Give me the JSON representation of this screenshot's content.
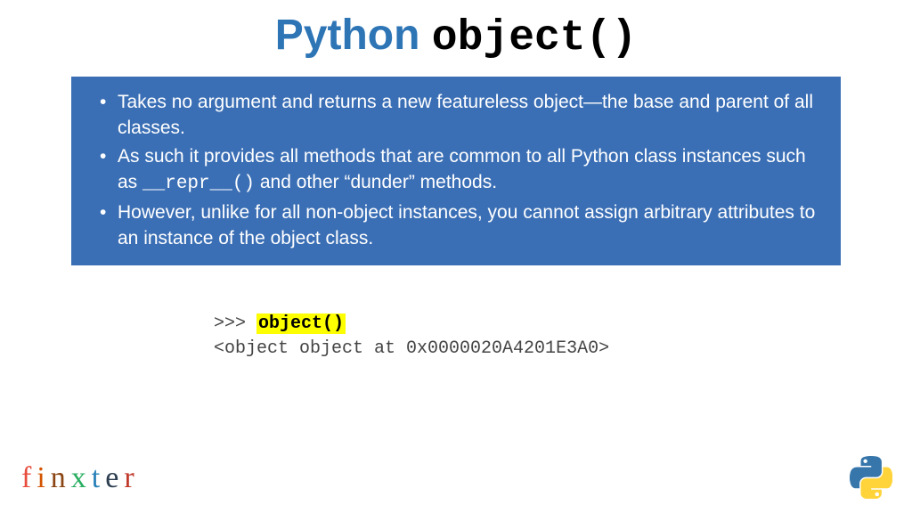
{
  "title": {
    "prefix": "Python ",
    "code": "object()"
  },
  "bullets": {
    "item1": "Takes no argument and returns a new featureless object—the base and parent of all classes.",
    "item2a": "As such it provides all methods that are common to all Python class instances such as ",
    "item2code": "__repr__()",
    "item2b": " and other “dunder” methods.",
    "item3": "However, unlike for all non-object instances, you cannot assign arbitrary attributes to an instance of the object class."
  },
  "code": {
    "prompt": ">>> ",
    "call": "object()",
    "output": "<object object at 0x0000020A4201E3A0>"
  },
  "logo": {
    "f": "f",
    "i": "i",
    "n": "n",
    "x": "x",
    "t": "t",
    "e": "e",
    "r": "r"
  }
}
